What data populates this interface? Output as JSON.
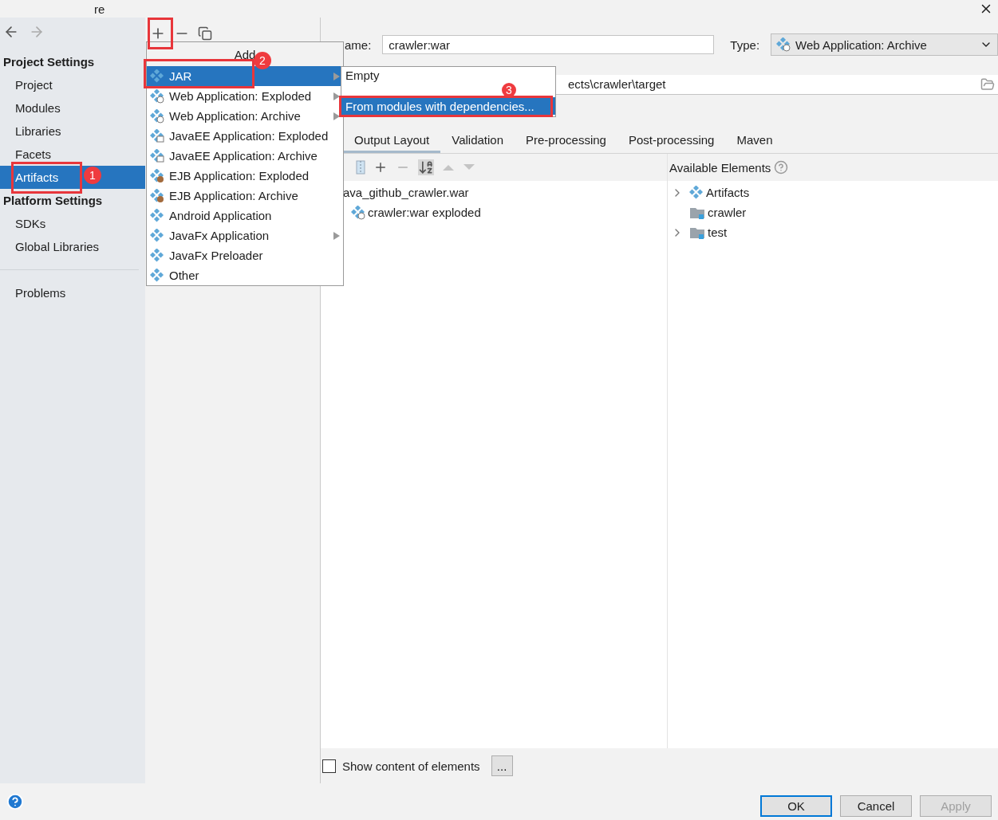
{
  "window": {
    "title": "re"
  },
  "sidebar": {
    "groups": [
      {
        "heading": "Project Settings",
        "items": [
          {
            "label": "Project",
            "selected": false
          },
          {
            "label": "Modules",
            "selected": false
          },
          {
            "label": "Libraries",
            "selected": false
          },
          {
            "label": "Facets",
            "selected": false
          },
          {
            "label": "Artifacts",
            "selected": true
          }
        ]
      },
      {
        "heading": "Platform Settings",
        "items": [
          {
            "label": "SDKs",
            "selected": false
          },
          {
            "label": "Global Libraries",
            "selected": false
          }
        ]
      }
    ],
    "bottom_items": [
      {
        "label": "Problems",
        "selected": false
      }
    ]
  },
  "artifact": {
    "name_label": "ame:",
    "name_value": "crawler:war",
    "type_label": "Type:",
    "type_value": "Web Application: Archive",
    "output_directory": "ects\\crawler\\target"
  },
  "tabs": [
    {
      "label": "Output Layout",
      "selected": true
    },
    {
      "label": "Validation",
      "selected": false
    },
    {
      "label": "Pre-processing",
      "selected": false
    },
    {
      "label": "Post-processing",
      "selected": false
    },
    {
      "label": "Maven",
      "selected": false
    }
  ],
  "layout_tree": [
    {
      "label": "ava_github_crawler.war",
      "kind": "plain",
      "children": [
        {
          "label": "crawler:war exploded",
          "kind": "web"
        }
      ]
    }
  ],
  "available_elements": {
    "title": "Available Elements",
    "items": [
      {
        "label": "Artifacts",
        "kind": "artifact",
        "expandable": true
      },
      {
        "label": "crawler",
        "kind": "module",
        "expandable": false
      },
      {
        "label": "test",
        "kind": "module",
        "expandable": true
      }
    ]
  },
  "show_content": {
    "label": "Show content of elements",
    "checked": false,
    "button": "..."
  },
  "buttons": [
    {
      "label": "OK",
      "default": true,
      "disabled": false
    },
    {
      "label": "Cancel",
      "default": false,
      "disabled": false
    },
    {
      "label": "Apply",
      "default": false,
      "disabled": true
    }
  ],
  "add_menu": {
    "header": "Add",
    "items": [
      {
        "label": "JAR",
        "kind": "plain",
        "submenu": true,
        "selected": true
      },
      {
        "label": "Web Application: Exploded",
        "kind": "web",
        "submenu": true,
        "selected": false
      },
      {
        "label": "Web Application: Archive",
        "kind": "web",
        "submenu": true,
        "selected": false
      },
      {
        "label": "JavaEE Application: Exploded",
        "kind": "javaee",
        "submenu": false,
        "selected": false
      },
      {
        "label": "JavaEE Application: Archive",
        "kind": "javaee",
        "submenu": false,
        "selected": false
      },
      {
        "label": "EJB Application: Exploded",
        "kind": "ejb",
        "submenu": false,
        "selected": false
      },
      {
        "label": "EJB Application: Archive",
        "kind": "ejb",
        "submenu": false,
        "selected": false
      },
      {
        "label": "Android Application",
        "kind": "plain",
        "submenu": false,
        "selected": false
      },
      {
        "label": "JavaFx Application",
        "kind": "plain",
        "submenu": true,
        "selected": false
      },
      {
        "label": "JavaFx Preloader",
        "kind": "plain",
        "submenu": false,
        "selected": false
      },
      {
        "label": "Other",
        "kind": "plain",
        "submenu": false,
        "selected": false
      }
    ]
  },
  "jar_submenu": [
    {
      "label": "Empty",
      "selected": false
    },
    {
      "label": "From modules with dependencies...",
      "selected": true
    }
  ],
  "annotations": [
    "1",
    "2",
    "3"
  ]
}
